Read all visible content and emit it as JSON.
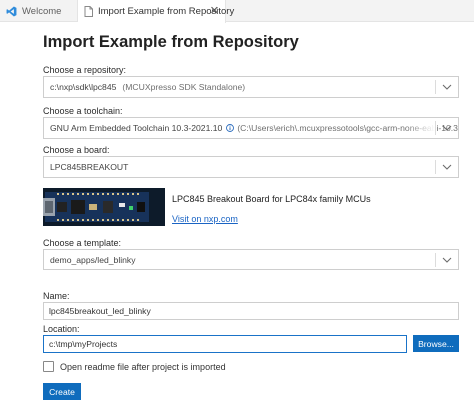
{
  "tabs": [
    {
      "label": "Welcome",
      "icon": "vscode-logo-icon",
      "active": false
    },
    {
      "label": "Import Example from Repository",
      "icon": "document-icon",
      "active": true
    }
  ],
  "title": "Import Example from Repository",
  "repository": {
    "label": "Choose a repository:",
    "value": "c:\\nxp\\sdk\\lpc845",
    "detail": "(MCUXpresso SDK Standalone)"
  },
  "toolchain": {
    "label": "Choose a toolchain:",
    "value": "GNU Arm Embedded Toolchain 10.3-2021.10",
    "detail": "(C:\\Users\\erich\\.mcuxpressotools\\gcc-arm-none-eabi-10.3-2"
  },
  "board": {
    "label": "Choose a board:",
    "value": "LPC845BREAKOUT",
    "description": "LPC845 Breakout Board for LPC84x family MCUs",
    "link": "Visit on nxp.com"
  },
  "template": {
    "label": "Choose a template:",
    "value": "demo_apps/led_blinky"
  },
  "name": {
    "label": "Name:",
    "value": "lpc845breakout_led_blinky"
  },
  "location": {
    "label": "Location:",
    "value": "c:\\tmp\\myProjects",
    "browse_label": "Browse..."
  },
  "readme": {
    "label": "Open readme file after project is imported",
    "checked": false
  },
  "create_label": "Create",
  "colors": {
    "accent": "#0f6cbd",
    "link": "#1a64c4"
  }
}
